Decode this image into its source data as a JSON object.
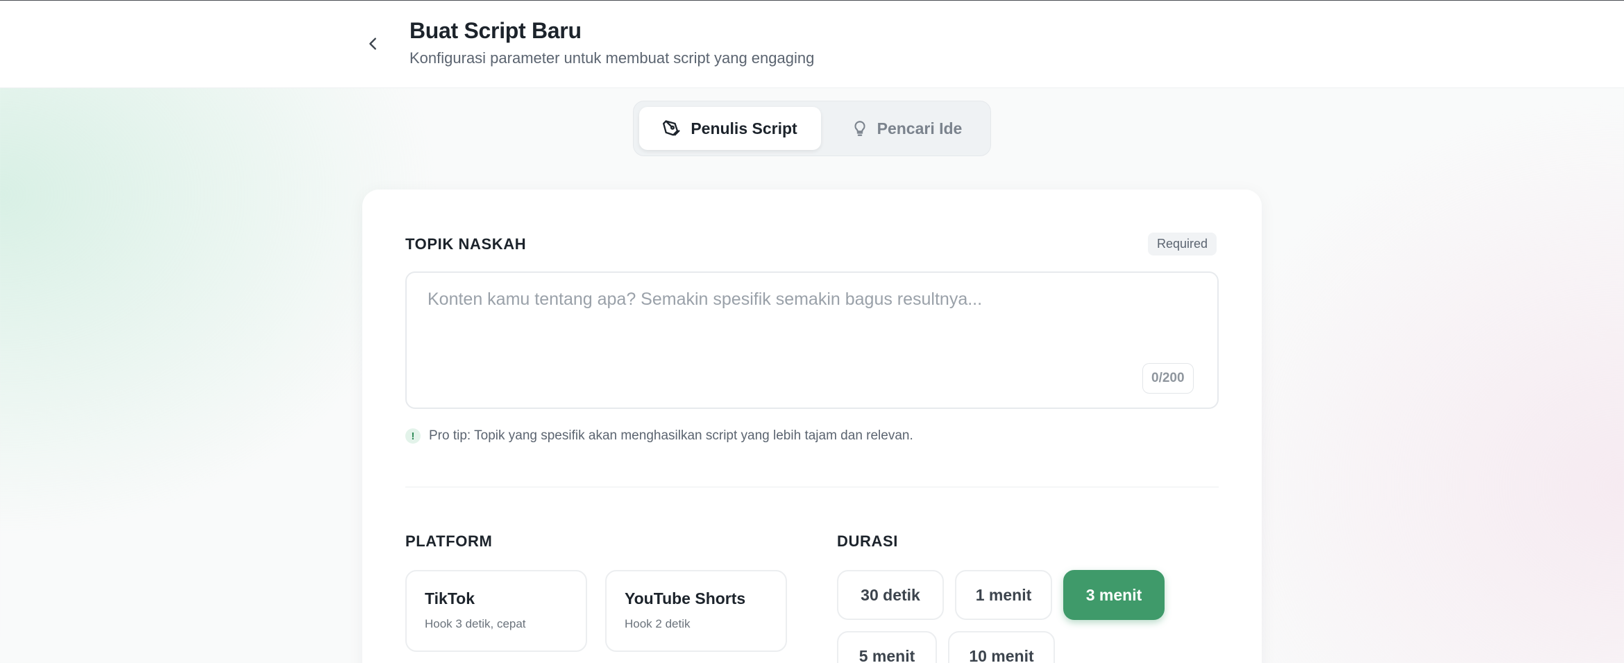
{
  "header": {
    "title": "Buat Script Baru",
    "subtitle": "Konfigurasi parameter untuk membuat script yang engaging"
  },
  "tabs": [
    {
      "label": "Penulis Script",
      "icon": "pen-tool-icon",
      "active": true
    },
    {
      "label": "Pencari Ide",
      "icon": "lightbulb-icon",
      "active": false
    }
  ],
  "topic": {
    "label": "TOPIK NASKAH",
    "badge": "Required",
    "value": "",
    "placeholder": "Konten kamu tentang apa? Semakin spesifik semakin bagus resultnya...",
    "counter": "0/200",
    "tip": "Pro tip: Topik yang spesifik akan menghasilkan script yang lebih tajam dan relevan.",
    "tip_icon": "!"
  },
  "platform": {
    "label": "PLATFORM",
    "options": [
      {
        "name": "TikTok",
        "desc": "Hook 3 detik, cepat"
      },
      {
        "name": "YouTube Shorts",
        "desc": "Hook 2 detik"
      }
    ]
  },
  "duration": {
    "label": "DURASI",
    "options": [
      "30 detik",
      "1 menit",
      "3 menit",
      "5 menit",
      "10 menit"
    ],
    "selected": "3 menit"
  },
  "colors": {
    "accent": "#3f9a6a",
    "text": "#1c232b",
    "muted": "#5b6470"
  }
}
